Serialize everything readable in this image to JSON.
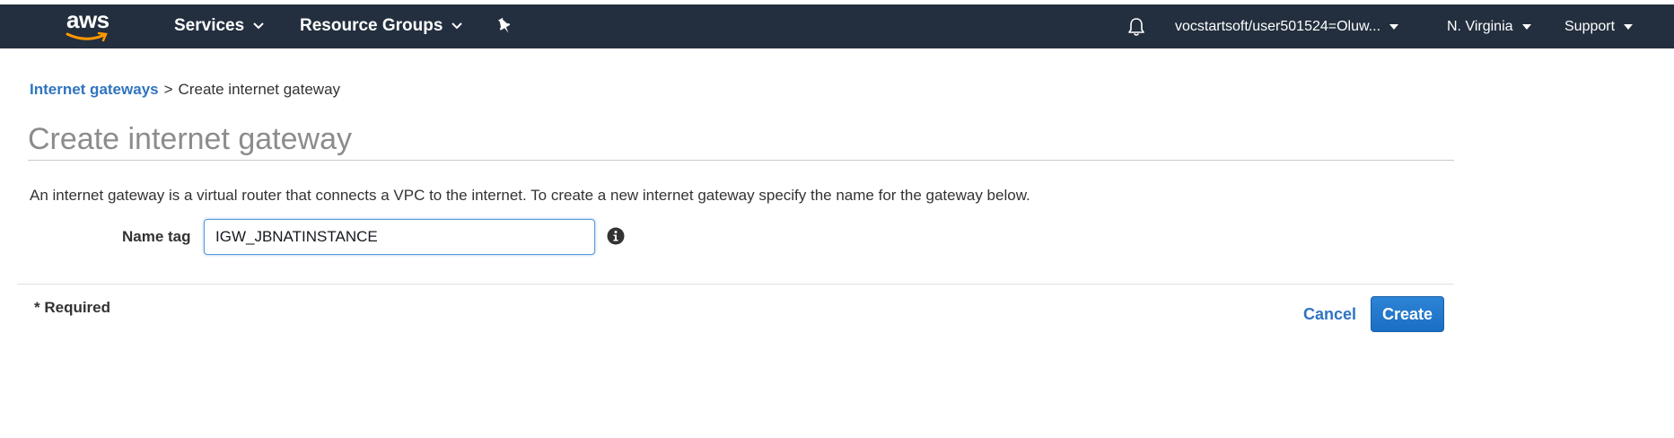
{
  "header": {
    "logo_text": "aws",
    "services_label": "Services",
    "resource_groups_label": "Resource Groups",
    "pin_icon": "pushpin-icon",
    "bell_icon": "bell-icon",
    "account_label": "vocstartsoft/user501524=Oluw...",
    "region_label": "N. Virginia",
    "support_label": "Support",
    "colors": {
      "bar": "#232f3e",
      "logo_smile": "#ff9900"
    }
  },
  "breadcrumb": {
    "parent_link": "Internet gateways",
    "separator": ">",
    "current": "Create internet gateway"
  },
  "page": {
    "title": "Create internet gateway",
    "description": "An internet gateway is a virtual router that connects a VPC to the internet. To create a new internet gateway specify the name for the gateway below."
  },
  "form": {
    "name_tag_label": "Name tag",
    "name_tag_value": "IGW_JBNATINSTANCE",
    "info_icon": "info-icon"
  },
  "footer": {
    "required_note": "* Required",
    "cancel_label": "Cancel",
    "create_label": "Create",
    "colors": {
      "primary": "#1a6fc4",
      "link": "#2f74c0"
    }
  }
}
